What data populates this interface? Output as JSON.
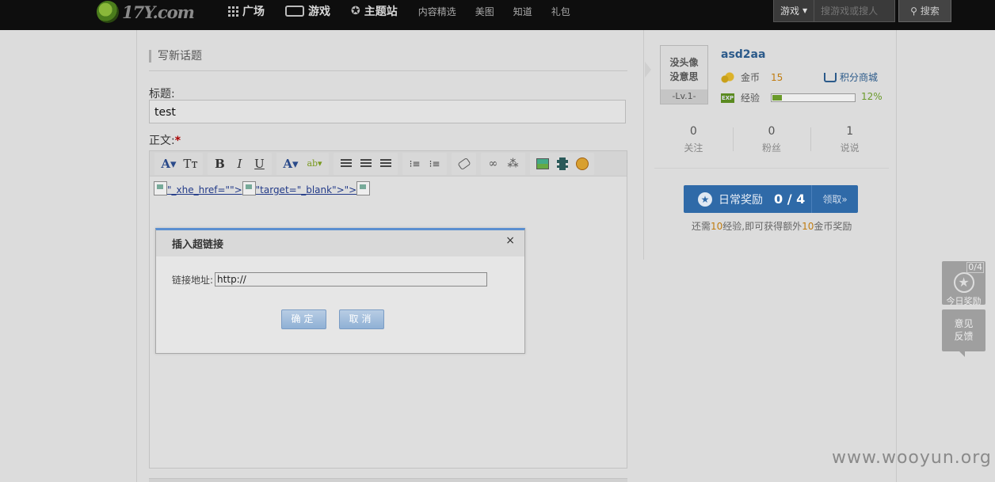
{
  "header": {
    "logo_text": "17Y.com",
    "nav": [
      {
        "label": "广场",
        "icon": "grid-icon"
      },
      {
        "label": "游戏",
        "icon": "gamepad-icon"
      },
      {
        "label": "主题站",
        "icon": "star-badge-icon"
      },
      {
        "label": "内容精选"
      },
      {
        "label": "美图"
      },
      {
        "label": "知道"
      },
      {
        "label": "礼包"
      }
    ],
    "search": {
      "category": "游戏",
      "placeholder": "搜游戏或搜人",
      "button": "搜索"
    }
  },
  "editor_page": {
    "section_title": "写新话题",
    "title_label": "标题:",
    "title_value": "test",
    "body_label": "正文:",
    "required_mark": "*",
    "content_links": [
      "\"_xhe_href=\"\">",
      "\"target=\"_blank\">\">"
    ]
  },
  "profile": {
    "avatar_text_line1": "没头像",
    "avatar_text_line2": "没意思",
    "level": "-Lv.1-",
    "username": "asd2aa",
    "coin_label": "金币",
    "coin_value": "15",
    "shop_link": "积分商城",
    "exp_label": "经验",
    "exp_icon_text": "EXP",
    "exp_percent": "12%",
    "exp_fraction": 0.12,
    "stats": [
      {
        "value": "0",
        "label": "关注"
      },
      {
        "value": "0",
        "label": "粉丝"
      },
      {
        "value": "1",
        "label": "说说"
      }
    ],
    "daily": {
      "label": "日常奖励",
      "count": "0 / 4",
      "claim": "领取»"
    },
    "daily_note": {
      "prefix": "还需",
      "exp": "10",
      "middle": "经验,即可获得额外",
      "coins": "10",
      "suffix": "金币奖励"
    }
  },
  "floating": {
    "reward_badge": "0/4",
    "reward_label": "今日奖励",
    "feedback_line1": "意见",
    "feedback_line2": "反馈"
  },
  "modal": {
    "title": "插入超链接",
    "close": "×",
    "field_label": "链接地址:",
    "field_value": "http://",
    "ok": "确定",
    "cancel": "取消"
  },
  "watermark": "www.wooyun.org"
}
